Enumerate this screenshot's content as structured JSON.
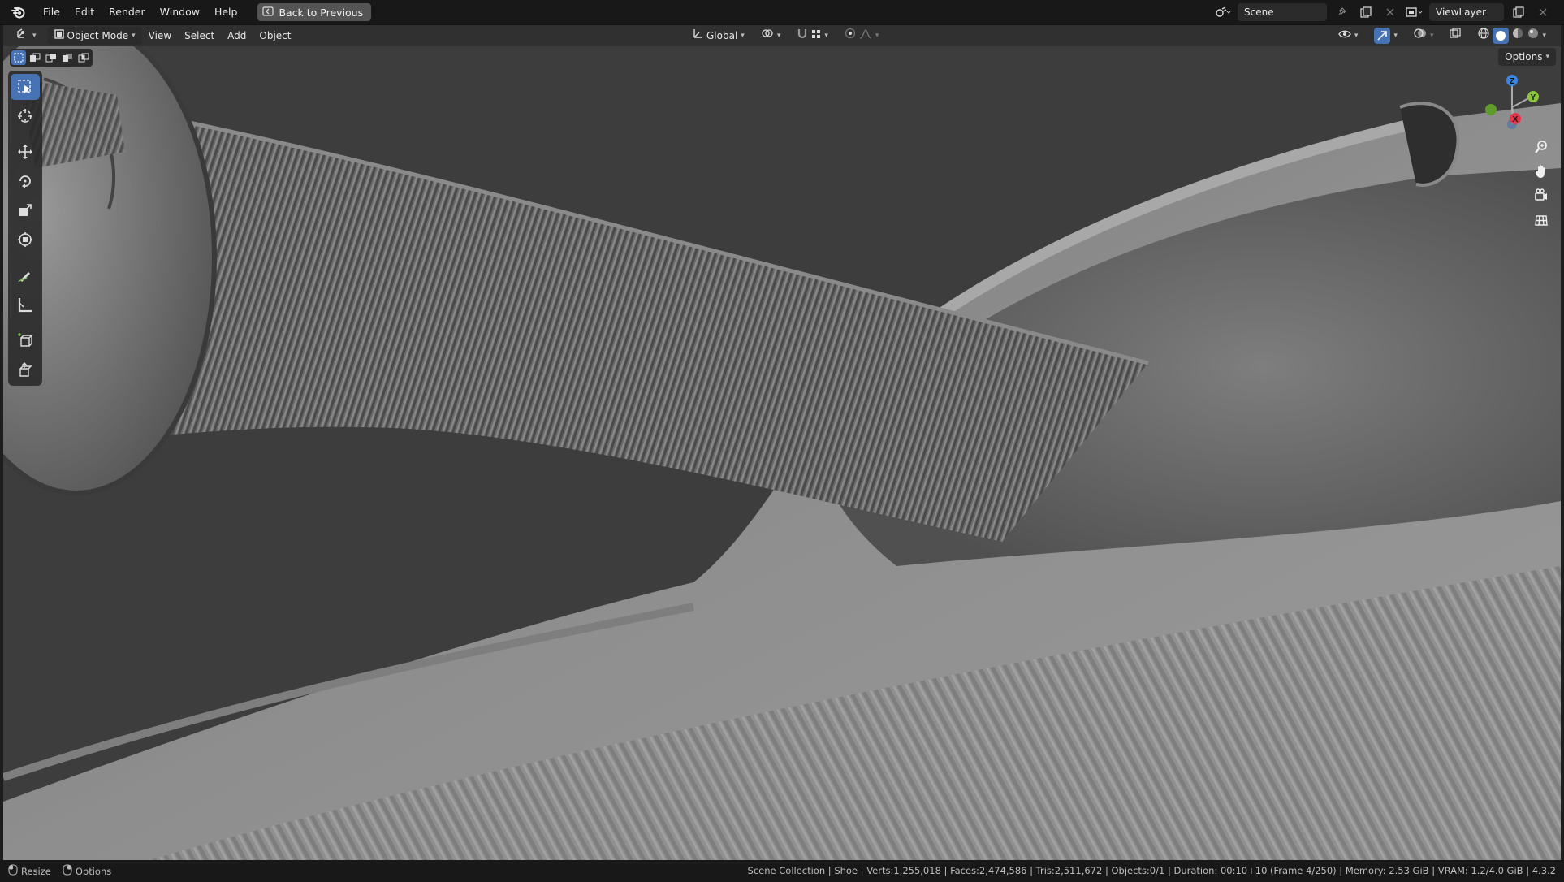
{
  "menubar": {
    "items": [
      "File",
      "Edit",
      "Render",
      "Window",
      "Help"
    ],
    "back_button": "Back to Previous",
    "scene_name": "Scene",
    "view_layer": "ViewLayer"
  },
  "header": {
    "mode": "Object Mode",
    "menus": [
      "View",
      "Select",
      "Add",
      "Object"
    ],
    "transform_orientation": "Global"
  },
  "viewport": {
    "options_label": "Options",
    "gizmo_axes": {
      "z": "Z",
      "y": "Y",
      "x": "X"
    }
  },
  "statusbar": {
    "left": [
      {
        "icon": "mouse-left-icon",
        "label": "Resize"
      },
      {
        "icon": "mouse-right-icon",
        "label": "Options"
      }
    ],
    "info": "Scene Collection | Shoe | Verts:1,255,018 | Faces:2,474,586 | Tris:2,511,672 | Objects:0/1 | Duration: 00:10+10 (Frame 4/250) | Memory: 2.53 GiB | VRAM: 1.2/4.0 GiB | 4.3.2"
  },
  "colors": {
    "accent": "#4772b3",
    "axis_x": "#e8344b",
    "axis_y": "#8ac53a",
    "axis_z": "#3c86e3"
  }
}
